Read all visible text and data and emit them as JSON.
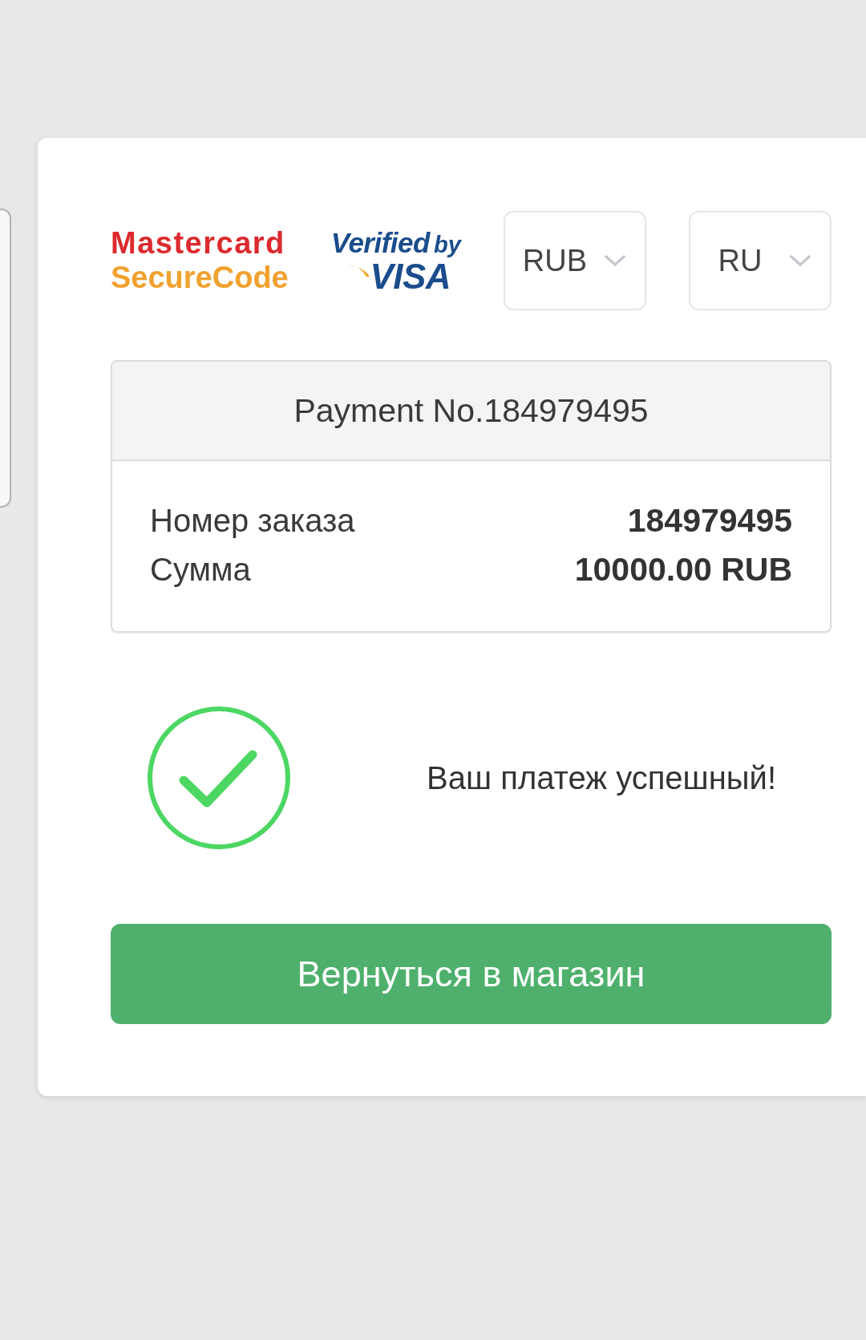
{
  "logos": [
    {
      "kind": "mastercard",
      "texts": [
        "Mastercard",
        "SecureCode"
      ]
    },
    {
      "kind": "visa",
      "texts": [
        "Verified",
        "by",
        "VISA"
      ]
    }
  ],
  "selects": [
    {
      "value": "RUB"
    },
    {
      "value": "RU"
    }
  ],
  "payment": {
    "title": "Payment No.184979495",
    "rows": [
      {
        "label": "Номер заказа",
        "value": "184979495"
      },
      {
        "label": "Сумма",
        "value": "10000.00 RUB"
      }
    ]
  },
  "status": {
    "kind": "success",
    "message": "Ваш платеж успешный!"
  },
  "return_button": {
    "label": "Вернуться в магазин"
  }
}
